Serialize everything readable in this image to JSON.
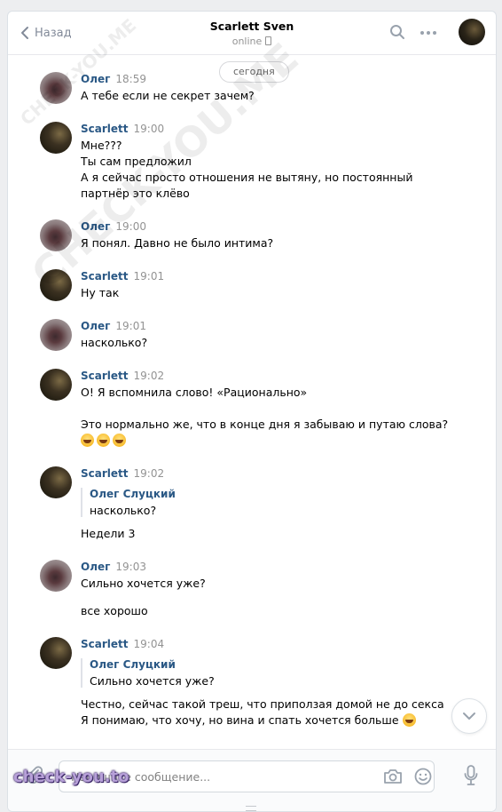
{
  "header": {
    "back_label": "Назад",
    "title": "Scarlett Sven",
    "status": "online"
  },
  "date_divider": "сегодня",
  "messages": [
    {
      "name": "Олег",
      "time": "18:59",
      "lines": [
        "А тебе если не секрет зачем?"
      ]
    },
    {
      "name": "Scarlett",
      "time": "19:00",
      "lines": [
        "Мне???",
        "Ты сам предложил",
        "А я сейчас просто отношения не вытяну, но постоянный",
        "партнёр это клёво"
      ]
    },
    {
      "name": "Олег",
      "time": "19:00",
      "lines": [
        "Я понял. Давно не было интима?"
      ]
    },
    {
      "name": "Scarlett",
      "time": "19:01",
      "lines": [
        "Ну так"
      ]
    },
    {
      "name": "Олег",
      "time": "19:01",
      "lines": [
        "насколько?"
      ]
    },
    {
      "name": "Scarlett",
      "time": "19:02",
      "lines": [
        "О! Я вспомнила слово! «Рационально»",
        "Это нормально же, что в конце дня я забываю и путаю слова?"
      ]
    },
    {
      "name": "Scarlett",
      "time": "19:02",
      "quote": {
        "name": "Олег Слуцкий",
        "text": "насколько?"
      },
      "lines": [
        "Недели 3"
      ]
    },
    {
      "name": "Олег",
      "time": "19:03",
      "lines": [
        "Сильно хочется уже?",
        "все хорошо"
      ]
    },
    {
      "name": "Scarlett",
      "time": "19:04",
      "quote": {
        "name": "Олег Слуцкий",
        "text": "Сильно хочется уже?"
      },
      "lines": [
        "Честно, сейчас такой треш, что приползая домой не до секса",
        "Я понимаю, что хочу, но вина и спать хочется больше"
      ]
    }
  ],
  "composer": {
    "placeholder": "Напишите сообщение..."
  },
  "watermarks": {
    "bottom": "check-you.to",
    "diagonal": "CHECK-YOU.ME"
  },
  "icons": [
    "chevron-left-icon",
    "mobile-phone-icon",
    "search-icon",
    "more-icon",
    "chevron-down-icon",
    "paperclip-icon",
    "camera-icon",
    "smile-icon",
    "microphone-icon",
    "laughing-emoji-icon"
  ],
  "colors": {
    "name": "#2a5885",
    "time": "#939393",
    "accent": "#5181b8",
    "background": "#edeef0"
  }
}
